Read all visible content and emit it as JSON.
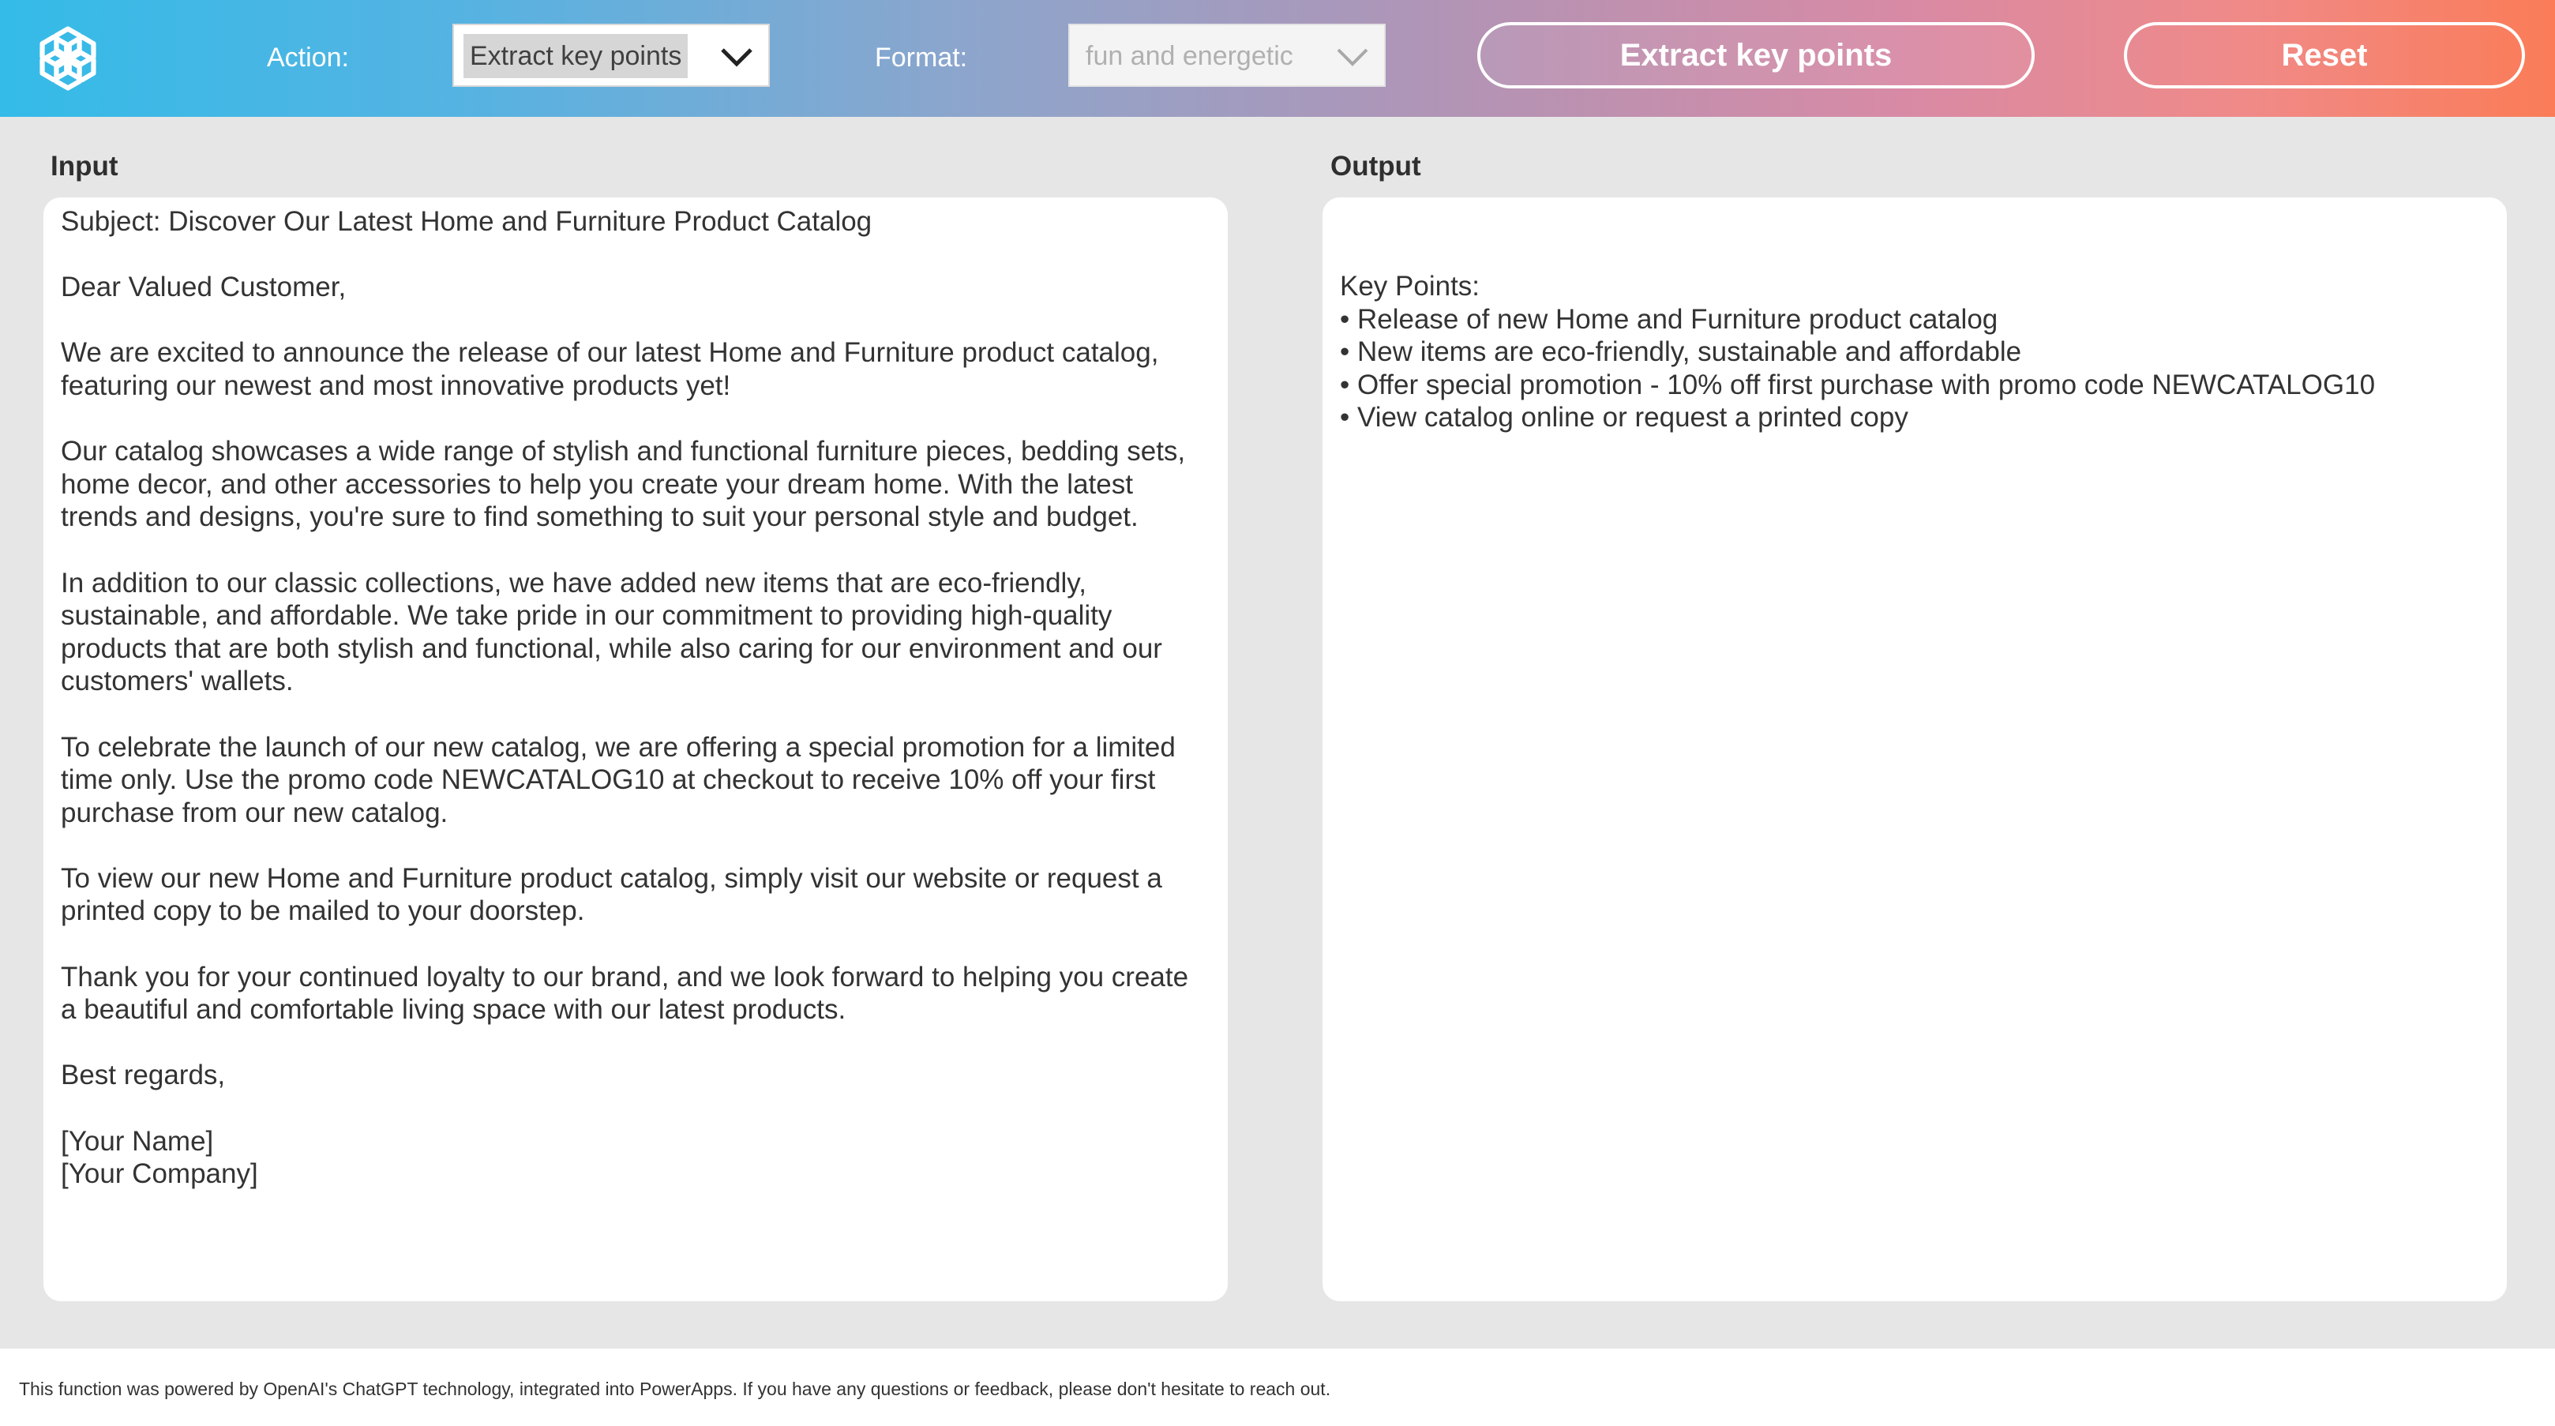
{
  "header": {
    "logo_icon": "openai-logo-icon",
    "action_label": "Action:",
    "action_value": "Extract key points",
    "format_label": "Format:",
    "format_value": "fun and energetic",
    "extract_button": "Extract key points",
    "reset_button": "Reset",
    "chevron_icon": "chevron-down-icon"
  },
  "input": {
    "label": "Input",
    "paragraphs": [
      "Subject: Discover Our Latest Home and Furniture Product Catalog",
      "Dear Valued Customer,",
      "We are excited to announce the release of our latest Home and Furniture product catalog, featuring our newest and most innovative products yet!",
      "Our catalog showcases a wide range of stylish and functional furniture pieces, bedding sets, home decor, and other accessories to help you create your dream home. With the latest trends and designs, you're sure to find something to suit your personal style and budget.",
      "In addition to our classic collections, we have added new items that are eco-friendly, sustainable, and affordable. We take pride in our commitment to providing high-quality products that are both stylish and functional, while also caring for our environment and our customers' wallets.",
      "To celebrate the launch of our new catalog, we are offering a special promotion for a limited time only. Use the promo code NEWCATALOG10 at checkout to receive 10% off your first purchase from our new catalog.",
      "To view our new Home and Furniture product catalog, simply visit our website or request a printed copy to be mailed to your doorstep.",
      "Thank you for your continued loyalty to our brand, and we look forward to helping you create a beautiful and comfortable living space with our latest products.",
      "Best regards,"
    ],
    "signature": [
      "[Your Name]",
      "[Your Company]"
    ]
  },
  "output": {
    "label": "Output",
    "heading": "Key Points:",
    "bullets": [
      "• Release of new Home and Furniture product catalog",
      "• New items are eco-friendly, sustainable and affordable",
      "• Offer special promotion - 10% off first purchase with promo code NEWCATALOG10",
      "• View catalog online or request a printed copy"
    ]
  },
  "footer": {
    "text": "This function was powered by OpenAI's ChatGPT technology, integrated into PowerApps. If you have any questions or feedback, please don't hesitate to reach out."
  },
  "colors": {
    "header_gradient_start": "#34bbe8",
    "header_gradient_end": "#fb7c57",
    "body_background": "#e6e6e6",
    "pane_background": "#ffffff"
  }
}
